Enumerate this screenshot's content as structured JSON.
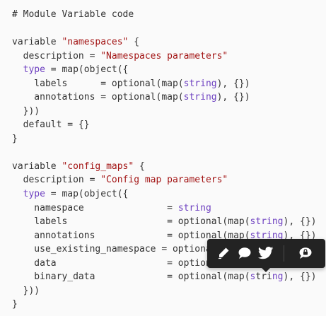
{
  "code": {
    "lines": [
      [
        {
          "t": "# Module Variable code",
          "c": "comment"
        }
      ],
      [],
      [
        {
          "t": "variable ",
          "c": "plain"
        },
        {
          "t": "\"namespaces\"",
          "c": "string"
        },
        {
          "t": " {",
          "c": "plain"
        }
      ],
      [
        {
          "t": "  description = ",
          "c": "plain"
        },
        {
          "t": "\"Namespaces parameters\"",
          "c": "string"
        }
      ],
      [
        {
          "t": "  ",
          "c": "plain"
        },
        {
          "t": "type",
          "c": "keyword"
        },
        {
          "t": " = map(object({",
          "c": "plain"
        }
      ],
      [
        {
          "t": "    labels      = optional(map(",
          "c": "plain"
        },
        {
          "t": "string",
          "c": "keyword"
        },
        {
          "t": "), {})",
          "c": "plain"
        }
      ],
      [
        {
          "t": "    annotations = optional(map(",
          "c": "plain"
        },
        {
          "t": "string",
          "c": "keyword"
        },
        {
          "t": "), {})",
          "c": "plain"
        }
      ],
      [
        {
          "t": "  }))",
          "c": "plain"
        }
      ],
      [
        {
          "t": "  default = {}",
          "c": "plain"
        }
      ],
      [
        {
          "t": "}",
          "c": "plain"
        }
      ],
      [],
      [
        {
          "t": "variable ",
          "c": "plain"
        },
        {
          "t": "\"config_maps\"",
          "c": "string"
        },
        {
          "t": " {",
          "c": "plain"
        }
      ],
      [
        {
          "t": "  description = ",
          "c": "plain"
        },
        {
          "t": "\"Config map parameters\"",
          "c": "string"
        }
      ],
      [
        {
          "t": "  ",
          "c": "plain"
        },
        {
          "t": "type",
          "c": "keyword"
        },
        {
          "t": " = map(object({",
          "c": "plain"
        }
      ],
      [
        {
          "t": "    namespace               = ",
          "c": "plain"
        },
        {
          "t": "string",
          "c": "keyword"
        }
      ],
      [
        {
          "t": "    labels                  = optional(map(",
          "c": "plain"
        },
        {
          "t": "string",
          "c": "keyword"
        },
        {
          "t": "), {})",
          "c": "plain"
        }
      ],
      [
        {
          "t": "    annotations             = optional(map(",
          "c": "plain"
        },
        {
          "t": "string",
          "c": "keyword"
        },
        {
          "t": "), {})",
          "c": "plain"
        }
      ],
      [
        {
          "t": "    use_existing_namespace = optional(bool, false)",
          "c": "plain"
        }
      ],
      [
        {
          "t": "    data                    = optional(map(",
          "c": "plain"
        },
        {
          "t": "string",
          "c": "keyword"
        },
        {
          "t": "), {})",
          "c": "plain"
        }
      ],
      [
        {
          "t": "    binary_data             = optional(map(",
          "c": "plain"
        },
        {
          "t": "s",
          "c": "keyword"
        },
        {
          "t": "tri",
          "c": "selected"
        },
        {
          "t": "ng",
          "c": "keyword"
        },
        {
          "t": "), {})",
          "c": "plain"
        }
      ],
      [
        {
          "t": "  }))",
          "c": "plain"
        }
      ],
      [
        {
          "t": "}",
          "c": "plain"
        }
      ]
    ]
  },
  "toolbar": {
    "items": [
      {
        "name": "highlight-pen-icon"
      },
      {
        "name": "comment-icon"
      },
      {
        "name": "twitter-icon"
      },
      {
        "name": "private-note-lock-icon"
      }
    ],
    "background": "#232323",
    "icon_color": "#ffffff"
  },
  "colors": {
    "string": "#a31515",
    "keyword": "#6f42c1",
    "text": "#333333",
    "selection": "#b5b5b5"
  }
}
